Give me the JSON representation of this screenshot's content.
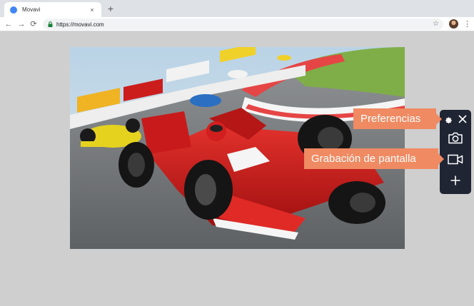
{
  "browser": {
    "tab_title": "Movavi",
    "tab_close": "×",
    "new_tab": "+",
    "url": "https://movavi.com",
    "back": "←",
    "forward": "→",
    "reload": "⟳",
    "bookmark": "☆",
    "menu": "⋮"
  },
  "callouts": {
    "preferences": "Preferencias",
    "screen_recording": "Grabación de pantalla"
  },
  "colors": {
    "callout": "#f08a62",
    "panel": "#1f2533",
    "favicon": "#4285f4"
  },
  "icons": {
    "panel": [
      "gear-icon",
      "close-icon",
      "camera-icon",
      "video-camera-icon",
      "plus-icon"
    ]
  }
}
